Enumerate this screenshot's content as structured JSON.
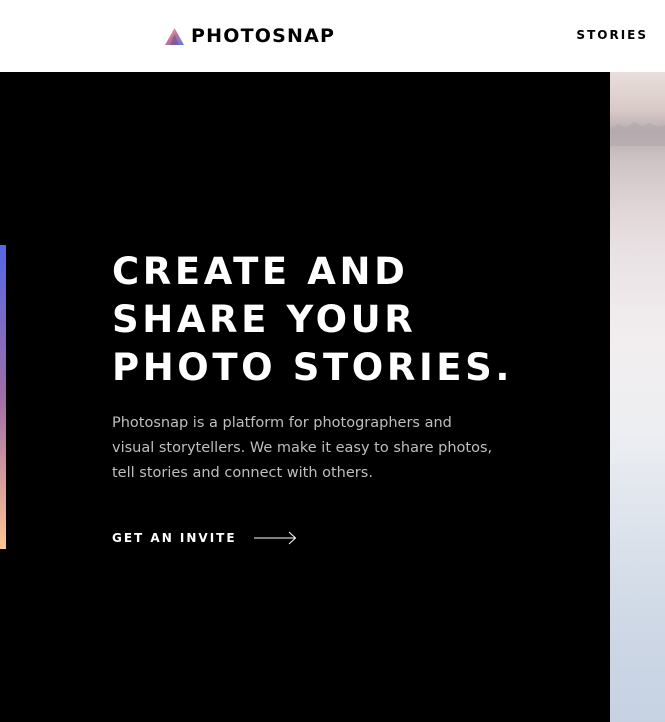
{
  "header": {
    "brand": "PHOTOSNAP",
    "nav": {
      "stories": "STORIES"
    }
  },
  "hero": {
    "title_lines": [
      "CREATE AND",
      "SHARE YOUR",
      "PHOTO STORIES."
    ],
    "description": "Photosnap is a platform for photographers and visual storytellers. We make it easy to share photos, tell stories and connect with others.",
    "cta": "GET AN INVITE"
  },
  "colors": {
    "accent_gradient": [
      "#5468e6",
      "#a06da8",
      "#ffc593"
    ],
    "hero_background": "#000000",
    "header_background": "#ffffff"
  },
  "icons": {
    "logo": "triangle-logo-icon",
    "cta": "arrow-right-icon"
  }
}
